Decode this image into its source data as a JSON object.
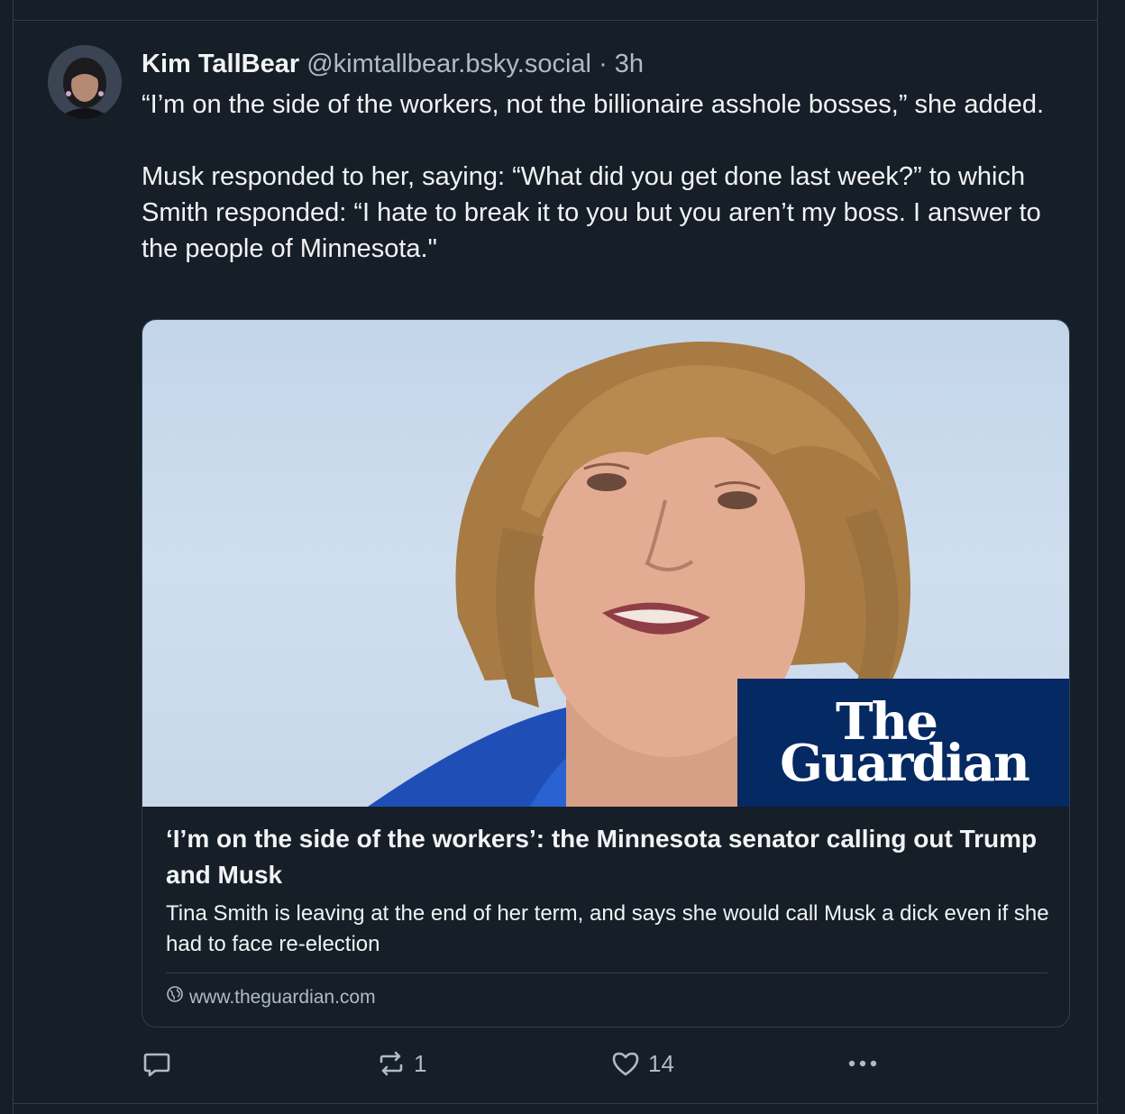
{
  "post": {
    "author_name": "Kim TallBear",
    "author_handle": "@kimtallbear.bsky.social",
    "separator": "·",
    "time": "3h",
    "paragraph_1": "“I’m on the side of the workers, not the billionaire asshole bosses,” she added.",
    "paragraph_2": "Musk responded to her, saying: “What did you get done last week?” to which Smith responded: “I hate to break it to you but you aren’t my boss. I answer to the people of Minnesota.\""
  },
  "link_card": {
    "logo_line_1": "The",
    "logo_line_2": "Guardian",
    "title": "‘I’m on the side of the workers’: the Minnesota senator calling out Trump and Musk",
    "description": "Tina Smith is leaving at the end of her term, and says she would call Musk a dick even if she had to face re-election",
    "domain": "www.theguardian.com"
  },
  "actions": {
    "reply_icon": "reply-icon",
    "repost_icon": "repost-icon",
    "repost_count": "1",
    "like_icon": "heart-icon",
    "like_count": "14",
    "more_icon": "more-icon"
  },
  "colors": {
    "background": "#161e27",
    "text": "#f1f3f5",
    "muted": "#aebbc9",
    "border": "#2e4052",
    "guardian_blue": "#052962"
  }
}
